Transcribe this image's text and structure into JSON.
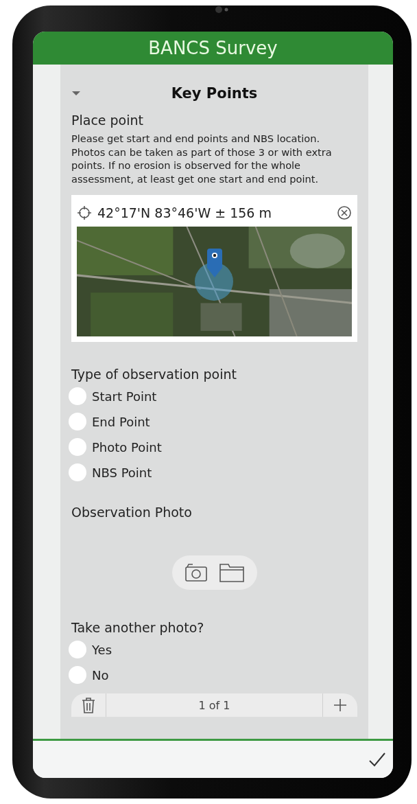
{
  "app": {
    "title": "BANCS Survey"
  },
  "group": {
    "title": "Key Points",
    "expanded": true
  },
  "place_point": {
    "label": "Place point",
    "hint": "Please get start and end points and NBS location. Photos can be taken as part of those 3 or with extra points. If no erosion is observed for the whole assessment, at least get one start and end point.",
    "coordinates": "42°17'N 83°46'W ± 156 m"
  },
  "observation_type": {
    "label": "Type of observation point",
    "options": [
      {
        "label": "Start Point",
        "selected": false
      },
      {
        "label": "End Point",
        "selected": false
      },
      {
        "label": "Photo Point",
        "selected": false
      },
      {
        "label": "NBS Point",
        "selected": false
      }
    ]
  },
  "photo": {
    "label": "Observation Photo"
  },
  "another_photo": {
    "label": "Take another photo?",
    "options": [
      {
        "label": "Yes",
        "selected": false
      },
      {
        "label": "No",
        "selected": false
      }
    ]
  },
  "pager": {
    "text": "1 of 1"
  }
}
